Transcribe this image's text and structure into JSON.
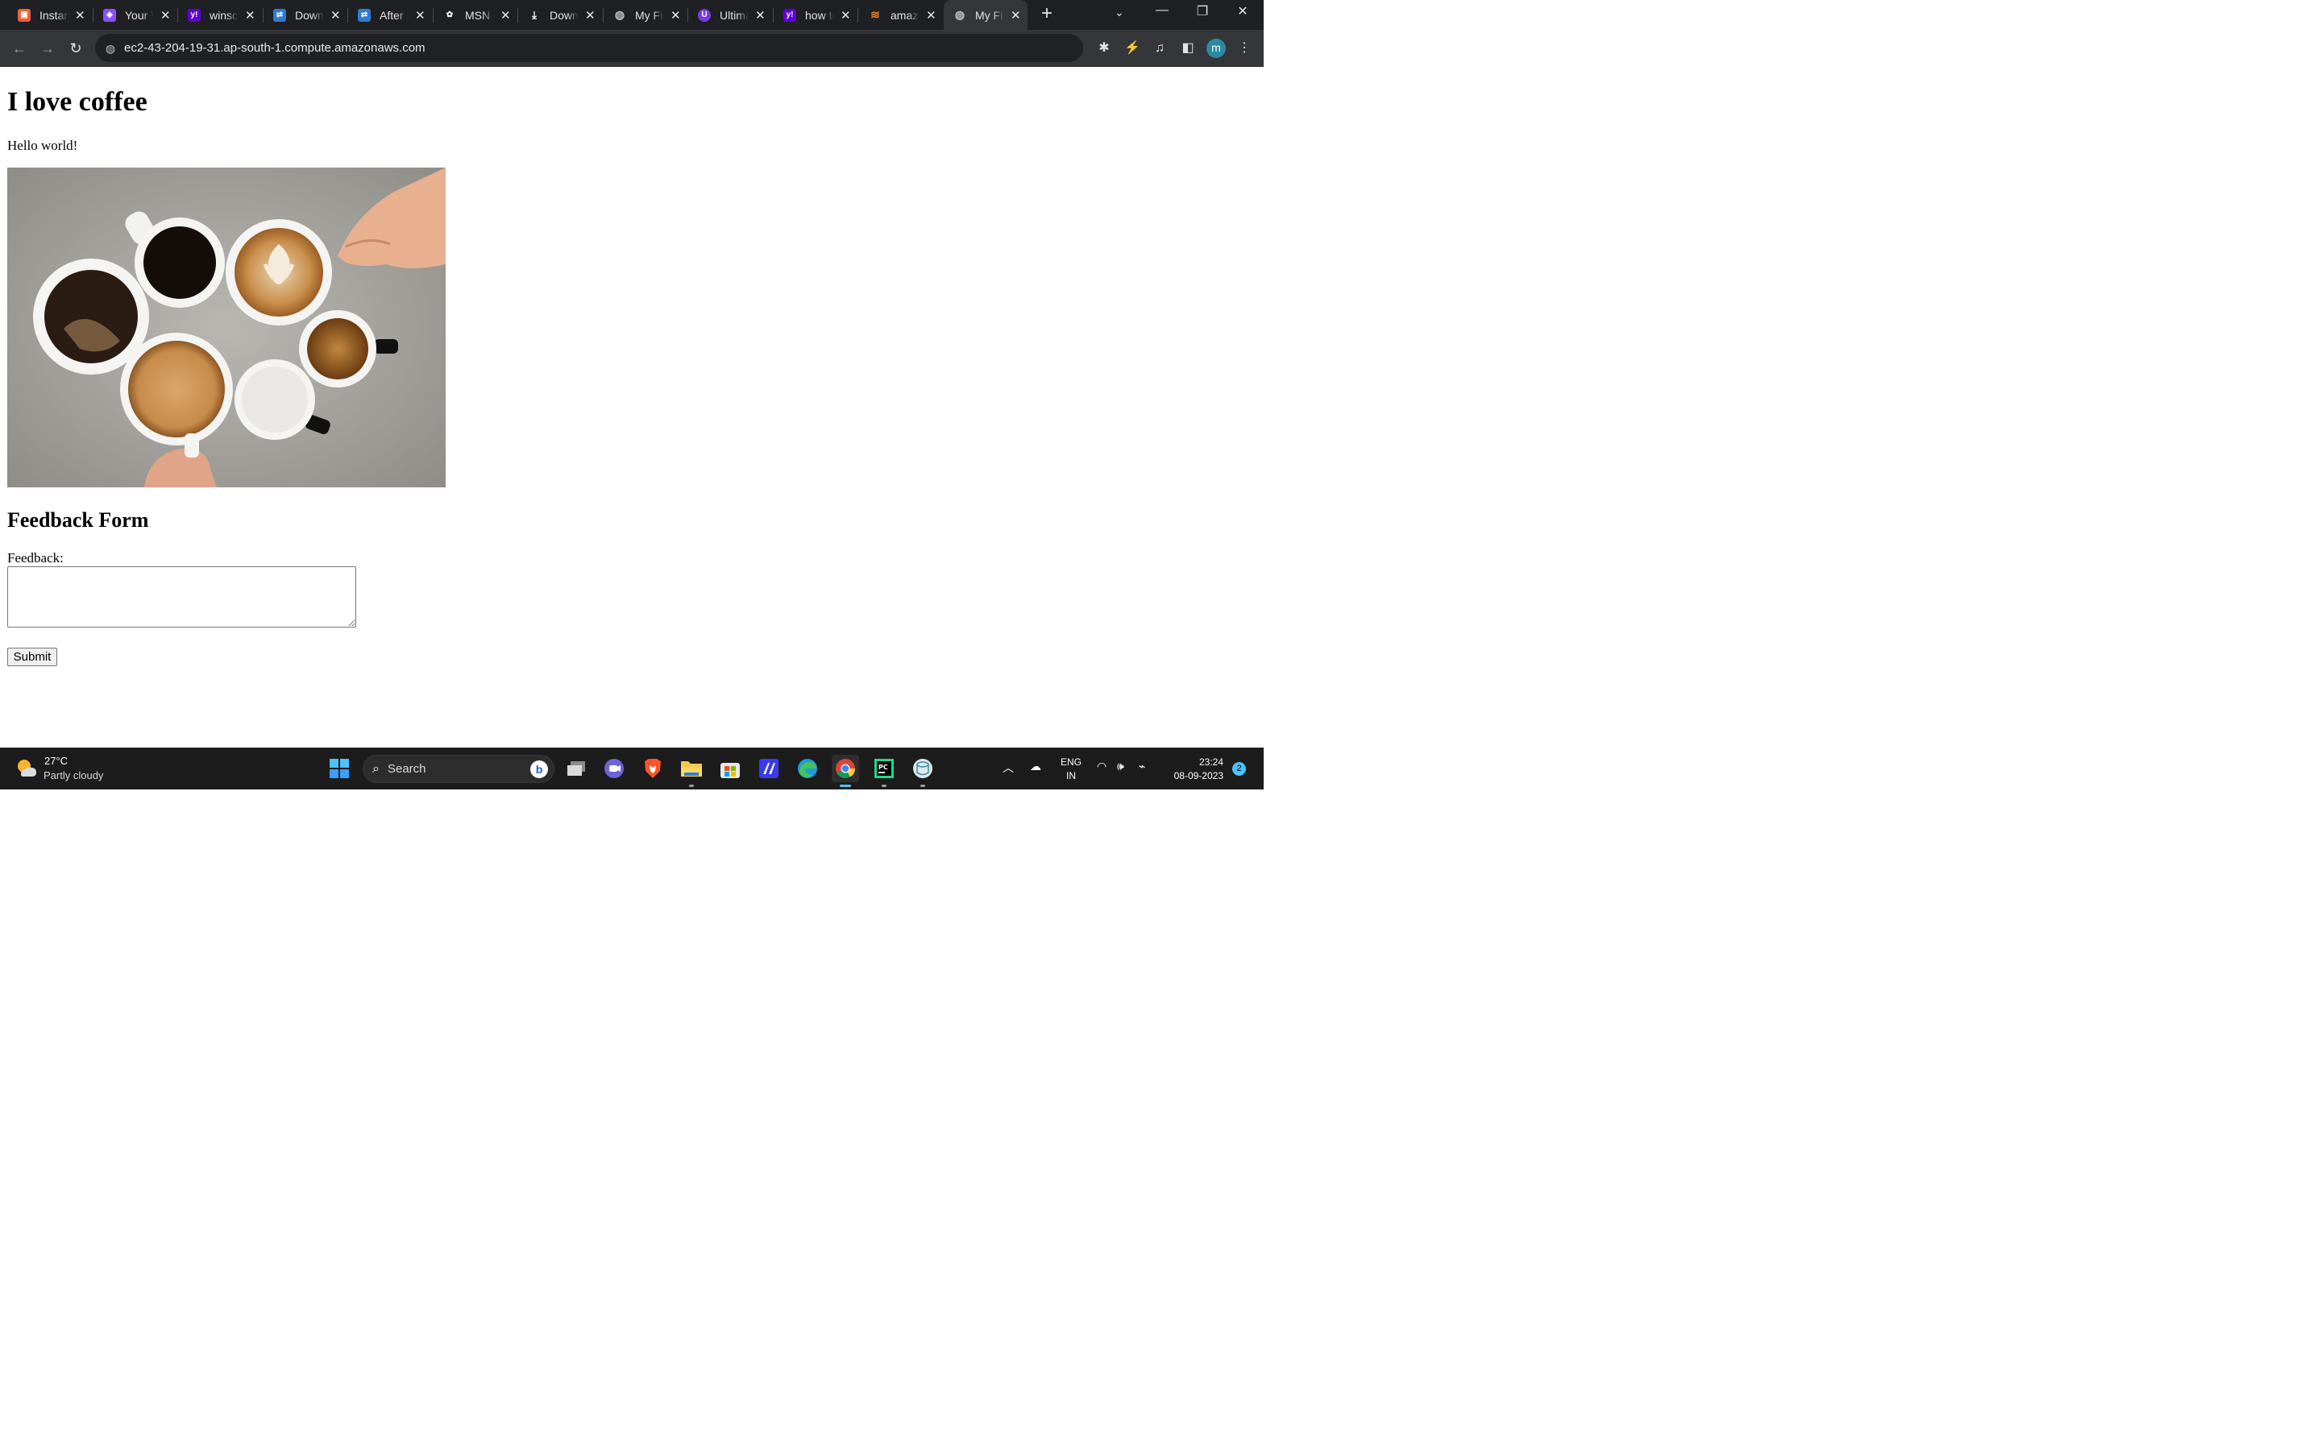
{
  "browser": {
    "tabs": [
      {
        "title": "Instances",
        "favicon": "aws-instances-icon",
        "color": "#e8633a"
      },
      {
        "title": "Your VPCs",
        "favicon": "vpc-icon",
        "color": "#8c4fff"
      },
      {
        "title": "winscp",
        "favicon": "yahoo-icon",
        "color": "#6001d2"
      },
      {
        "title": "Download",
        "favicon": "winscp-icon",
        "color": "#2f7bd0"
      },
      {
        "title": "After Installing",
        "favicon": "winscp-icon",
        "color": "#2f7bd0"
      },
      {
        "title": "MSN",
        "favicon": "msn-icon",
        "color": "#ffffff"
      },
      {
        "title": "Download",
        "favicon": "download-icon",
        "color": "#ffffff"
      },
      {
        "title": "My First",
        "favicon": "globe-icon",
        "color": "#bdc1c6"
      },
      {
        "title": "Ultimate",
        "favicon": "ublock-icon",
        "color": "#7a3be6"
      },
      {
        "title": "how to",
        "favicon": "yahoo-icon",
        "color": "#6001d2"
      },
      {
        "title": "amazon",
        "favicon": "stackoverflow-icon",
        "color": "#f48024"
      },
      {
        "title": "My First",
        "favicon": "globe-icon",
        "color": "#bdc1c6",
        "active": true
      }
    ],
    "url": "ec2-43-204-19-31.ap-south-1.compute.amazonaws.com",
    "avatar_letter": "m",
    "accent": "#2a8aa0"
  },
  "page": {
    "heading": "I love coffee",
    "intro": "Hello world!",
    "image_alt": "coffee cups",
    "form_title": "Feedback Form",
    "feedback_label": "Feedback:",
    "feedback_value": "",
    "submit_label": "Submit"
  },
  "taskbar": {
    "weather": {
      "temp": "27°C",
      "condition": "Partly cloudy"
    },
    "search_placeholder": "Search",
    "apps": [
      "start-icon",
      "task-view-icon",
      "teams-icon",
      "brave-icon",
      "file-explorer-icon",
      "ms-store-icon",
      "visual-studio-icon",
      "edge-icon",
      "chrome-icon",
      "pycharm-icon",
      "db-icon"
    ],
    "language": {
      "line1": "ENG",
      "line2": "IN"
    },
    "clock": {
      "time": "23:24",
      "date": "08-09-2023"
    },
    "notifications": "2"
  }
}
